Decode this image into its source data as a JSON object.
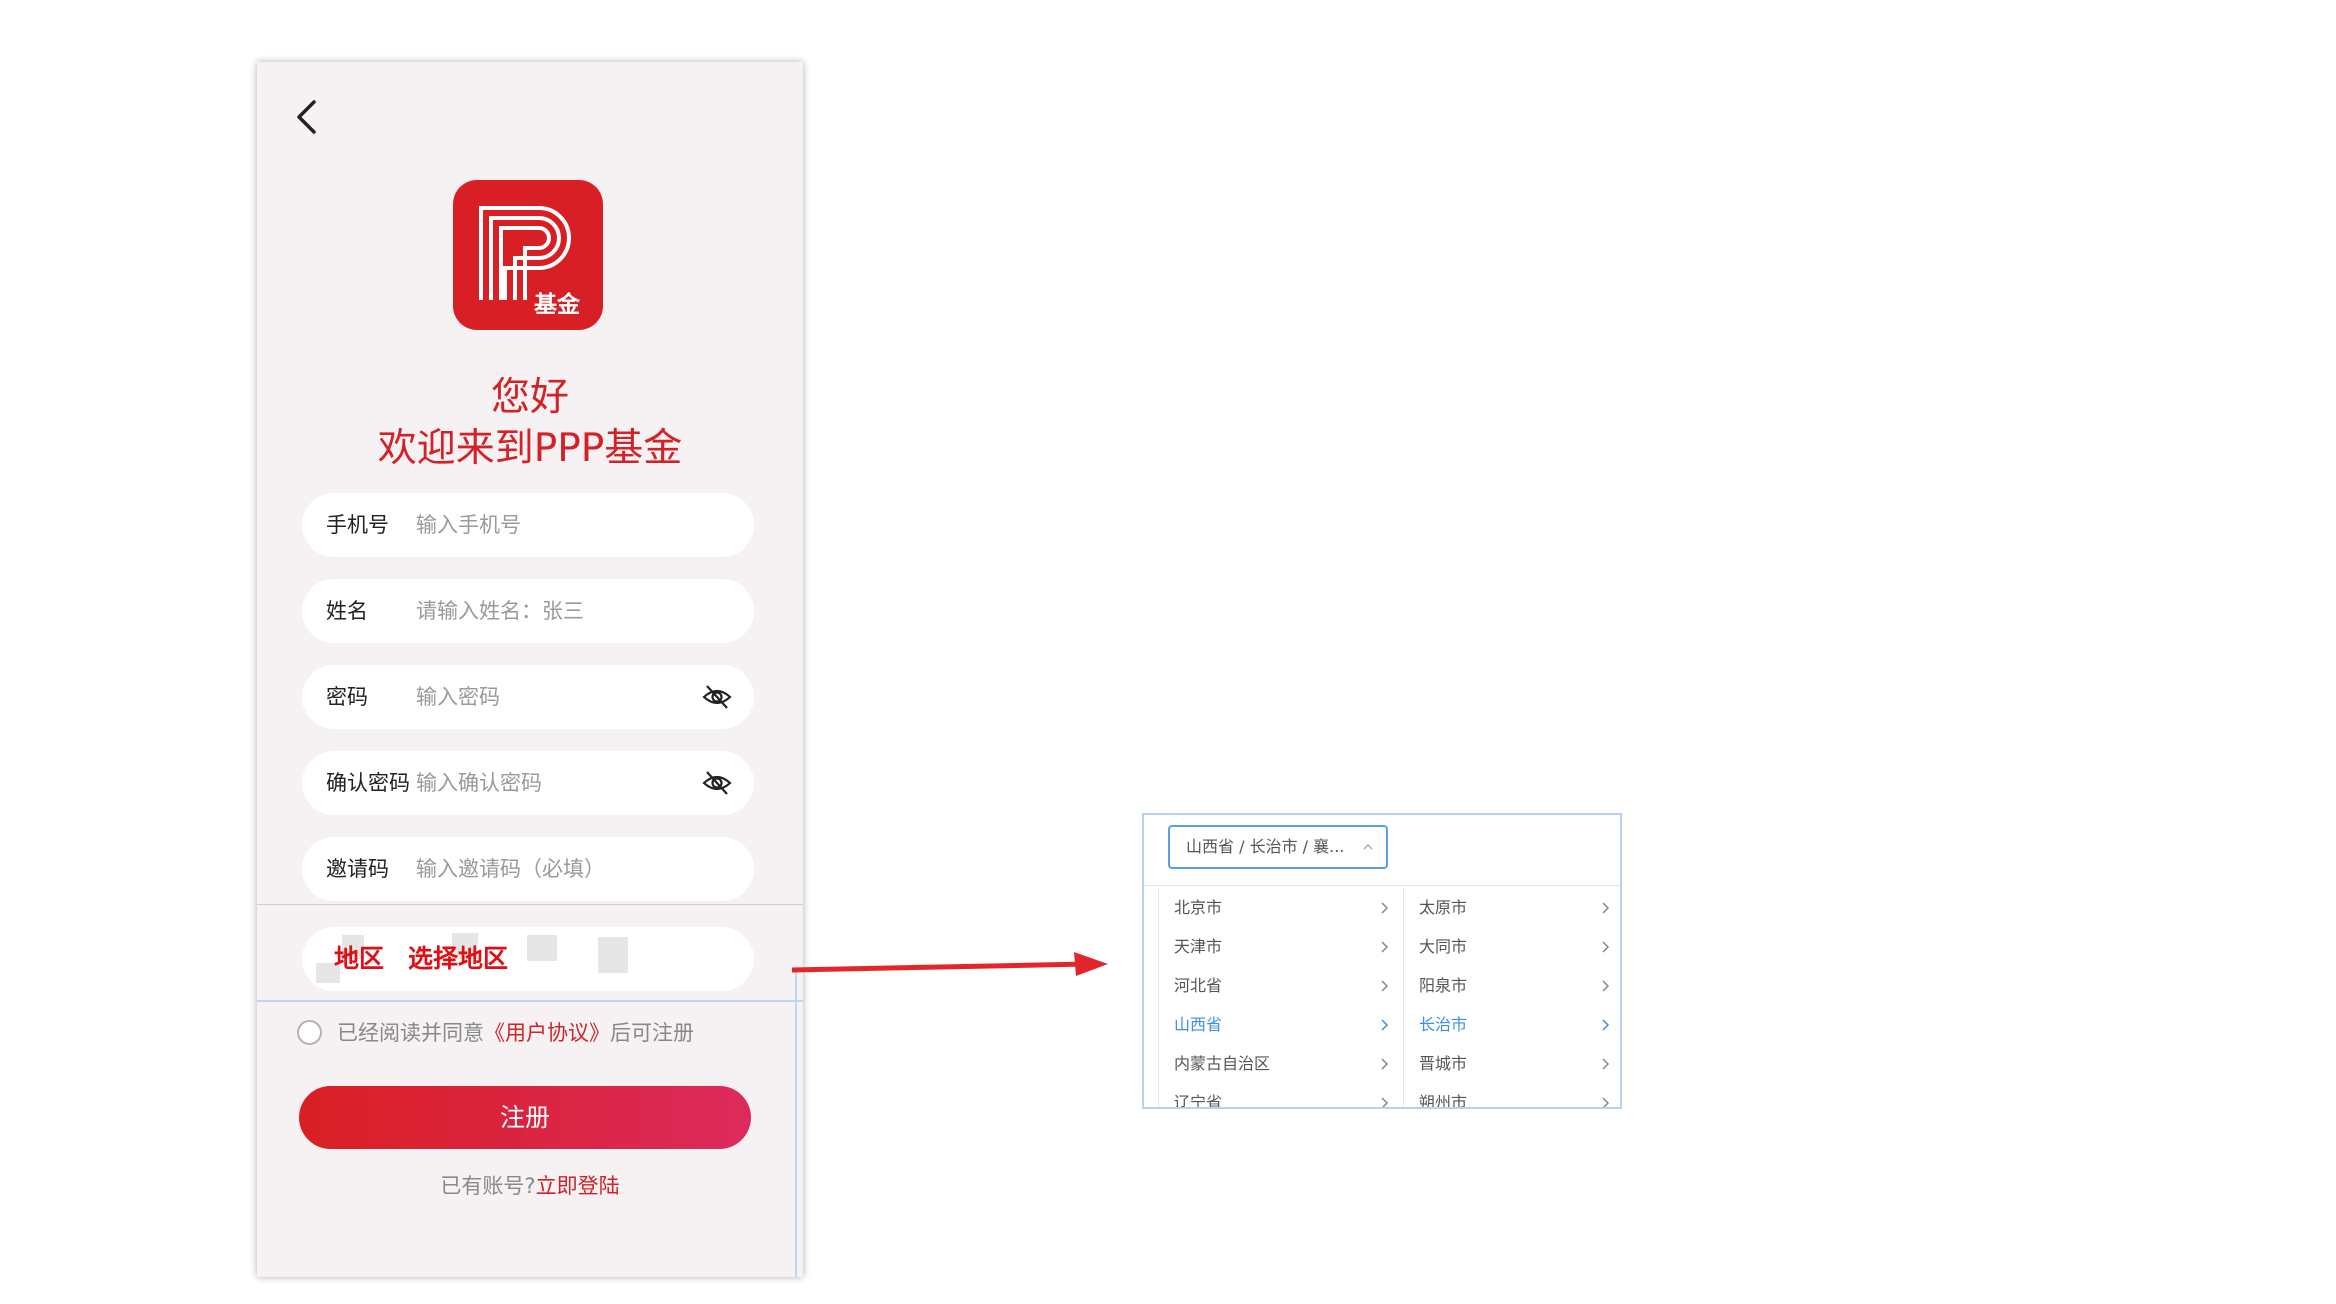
{
  "register_form": {
    "greeting_line1": "您好",
    "greeting_line2": "欢迎来到PPP基金",
    "logo_text": "基金",
    "fields": {
      "phone": {
        "label": "手机号",
        "placeholder": "输入手机号"
      },
      "name": {
        "label": "姓名",
        "placeholder": "请输入姓名：张三"
      },
      "password": {
        "label": "密码",
        "placeholder": "输入密码"
      },
      "confirm_password": {
        "label": "确认密码",
        "placeholder": "输入确认密码"
      },
      "invite_code": {
        "label": "邀请码",
        "placeholder": "输入邀请码（必填）"
      }
    },
    "region": {
      "label": "地区",
      "value": "选择地区"
    },
    "agreement": {
      "prefix": "已经阅读并同意",
      "link": "《用户协议》",
      "suffix": "后可注册"
    },
    "register_button": "注册",
    "login_prompt": "已有账号?",
    "login_link": "立即登陆"
  },
  "region_picker": {
    "input_value": "山西省 / 长治市 / 襄...",
    "provinces": [
      {
        "label": "北京市",
        "active": false
      },
      {
        "label": "天津市",
        "active": false
      },
      {
        "label": "河北省",
        "active": false
      },
      {
        "label": "山西省",
        "active": true
      },
      {
        "label": "内蒙古自治区",
        "active": false
      },
      {
        "label": "辽宁省",
        "active": false
      }
    ],
    "cities": [
      {
        "label": "太原市",
        "active": false
      },
      {
        "label": "大同市",
        "active": false
      },
      {
        "label": "阳泉市",
        "active": false
      },
      {
        "label": "长治市",
        "active": true
      },
      {
        "label": "晋城市",
        "active": false
      },
      {
        "label": "朔州市",
        "active": false
      }
    ]
  },
  "colors": {
    "brand_red": "#d42127",
    "picker_active_blue": "#3d8ee4",
    "annotation_red": "#e00f16"
  }
}
